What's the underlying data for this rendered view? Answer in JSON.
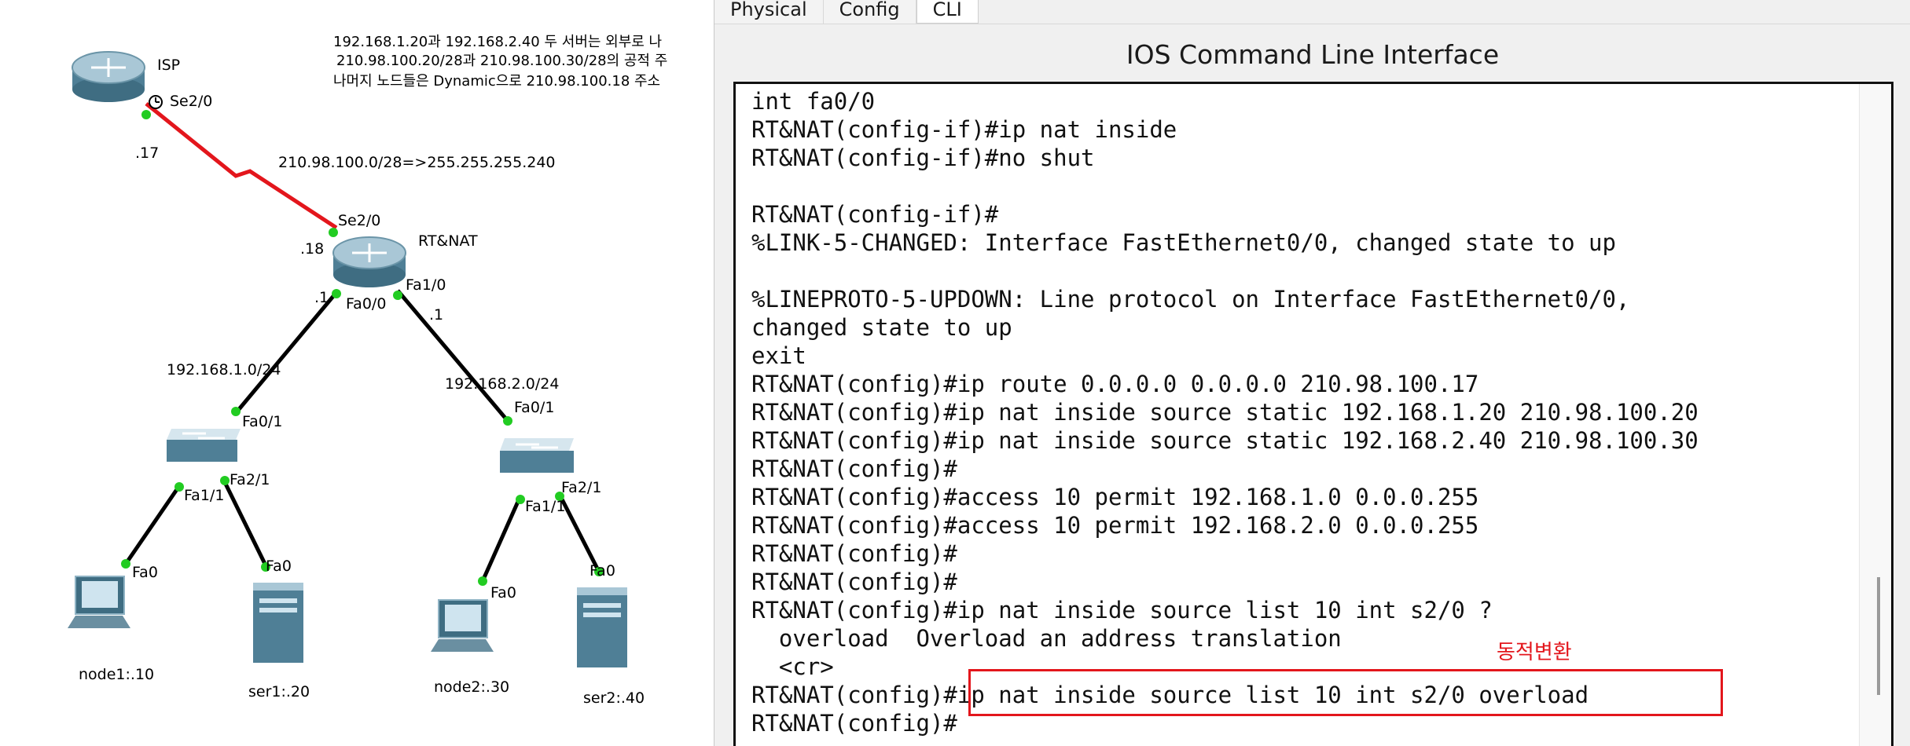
{
  "topology": {
    "note_lines": [
      "192.168.1.20과 192.168.2.40 두 서버는 외부로 나",
      "210.98.100.20/28과 210.98.100.30/28의 공적 주",
      "나머지 노드들은 Dynamic으로 210.98.100.18 주소"
    ],
    "labels": {
      "isp": "ISP",
      "isp_se": "Se2/0",
      "isp_ip": ".17",
      "wan_net": "210.98.100.0/28=>255.255.255.240",
      "rt_se": "Se2/0",
      "rt_se_ip": ".18",
      "rt": "RT&NAT",
      "rt_fa00_ip": ".1",
      "rt_fa00": "Fa0/0",
      "rt_fa10": "Fa1/0",
      "rt_fa10_ip": ".1",
      "net1": "192.168.1.0/24",
      "net2": "192.168.2.0/24",
      "sw1_fa01": "Fa0/1",
      "sw1_fa21": "Fa2/1",
      "sw1_fa11": "Fa1/1",
      "sw2_fa01": "Fa0/1",
      "sw2_fa21": "Fa2/1",
      "sw2_fa11": "Fa1/1",
      "node1_fa0": "Fa0",
      "ser1_fa0": "Fa0",
      "node2_fa0": "Fa0",
      "ser2_fa0": "Fa0",
      "node1": "node1:.10",
      "ser1": "ser1:.20",
      "node2": "node2:.30",
      "ser2": "ser2:.40"
    }
  },
  "device_window": {
    "tabs": [
      {
        "label": "Physical",
        "active": false
      },
      {
        "label": "Config",
        "active": false
      },
      {
        "label": "CLI",
        "active": true
      }
    ],
    "cli_title": "IOS Command Line Interface",
    "console_lines": [
      "int fa0/0",
      "RT&NAT(config-if)#ip nat inside",
      "RT&NAT(config-if)#no shut",
      "",
      "RT&NAT(config-if)#",
      "%LINK-5-CHANGED: Interface FastEthernet0/0, changed state to up",
      "",
      "%LINEPROTO-5-UPDOWN: Line protocol on Interface FastEthernet0/0,",
      "changed state to up",
      "exit",
      "RT&NAT(config)#ip route 0.0.0.0 0.0.0.0 210.98.100.17",
      "RT&NAT(config)#ip nat inside source static 192.168.1.20 210.98.100.20",
      "RT&NAT(config)#ip nat inside source static 192.168.2.40 210.98.100.30",
      "RT&NAT(config)#",
      "RT&NAT(config)#access 10 permit 192.168.1.0 0.0.0.255",
      "RT&NAT(config)#access 10 permit 192.168.2.0 0.0.0.255",
      "RT&NAT(config)#",
      "RT&NAT(config)#",
      "RT&NAT(config)#ip nat inside source list 10 int s2/0 ?",
      "  overload  Overload an address translation",
      "  <cr>",
      "RT&NAT(config)#ip nat inside source list 10 int s2/0 overload",
      "RT&NAT(config)#"
    ],
    "annotation": "동적변환",
    "colors": {
      "highlight": "#e3161c",
      "link_serial": "#e3161c",
      "link_ok": "#22cc22"
    }
  }
}
